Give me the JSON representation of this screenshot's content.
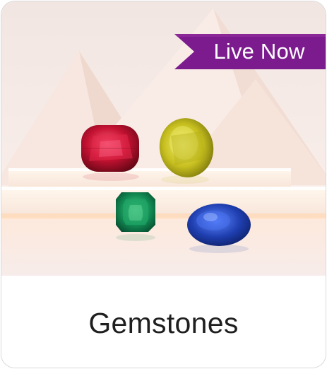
{
  "card": {
    "title": "Gemstones",
    "badge_label": "Live Now",
    "badge_color": "#7b1b8d"
  },
  "gems": [
    {
      "name": "ruby",
      "color": "#c41232"
    },
    {
      "name": "yellow-sapphire",
      "color": "#c8c020"
    },
    {
      "name": "emerald",
      "color": "#128a52"
    },
    {
      "name": "blue-sapphire",
      "color": "#1f3fb0"
    }
  ]
}
